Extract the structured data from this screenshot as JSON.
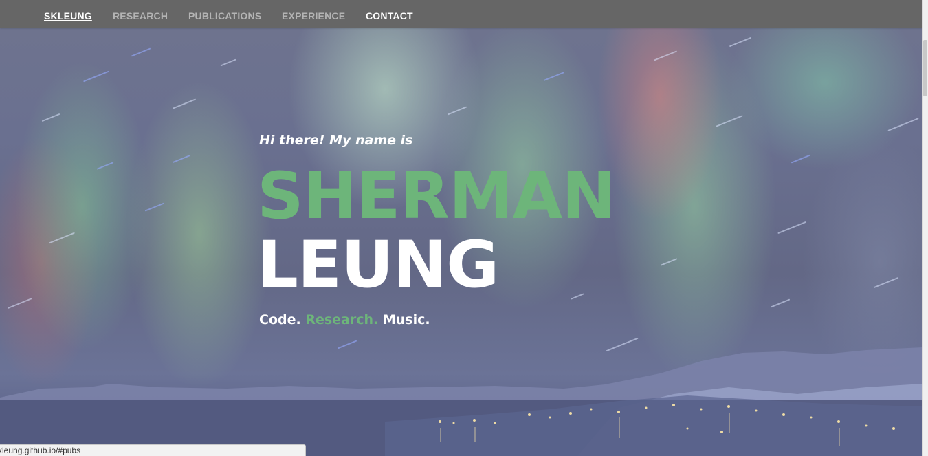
{
  "nav": {
    "brand": "SKLEUNG",
    "items": [
      {
        "label": "RESEARCH"
      },
      {
        "label": "PUBLICATIONS"
      },
      {
        "label": "EXPERIENCE"
      },
      {
        "label": "CONTACT"
      }
    ]
  },
  "hero": {
    "greeting": "Hi there! My name is",
    "first_name": "SHERMAN",
    "last_name": "LEUNG",
    "tagline": {
      "part1": "Code.",
      "part2": "Research.",
      "part3": "Music."
    }
  },
  "status_bar": {
    "url": "kleung.github.io/#pubs"
  },
  "colors": {
    "accent_green": "#6db57a",
    "navbar": "#666666"
  }
}
